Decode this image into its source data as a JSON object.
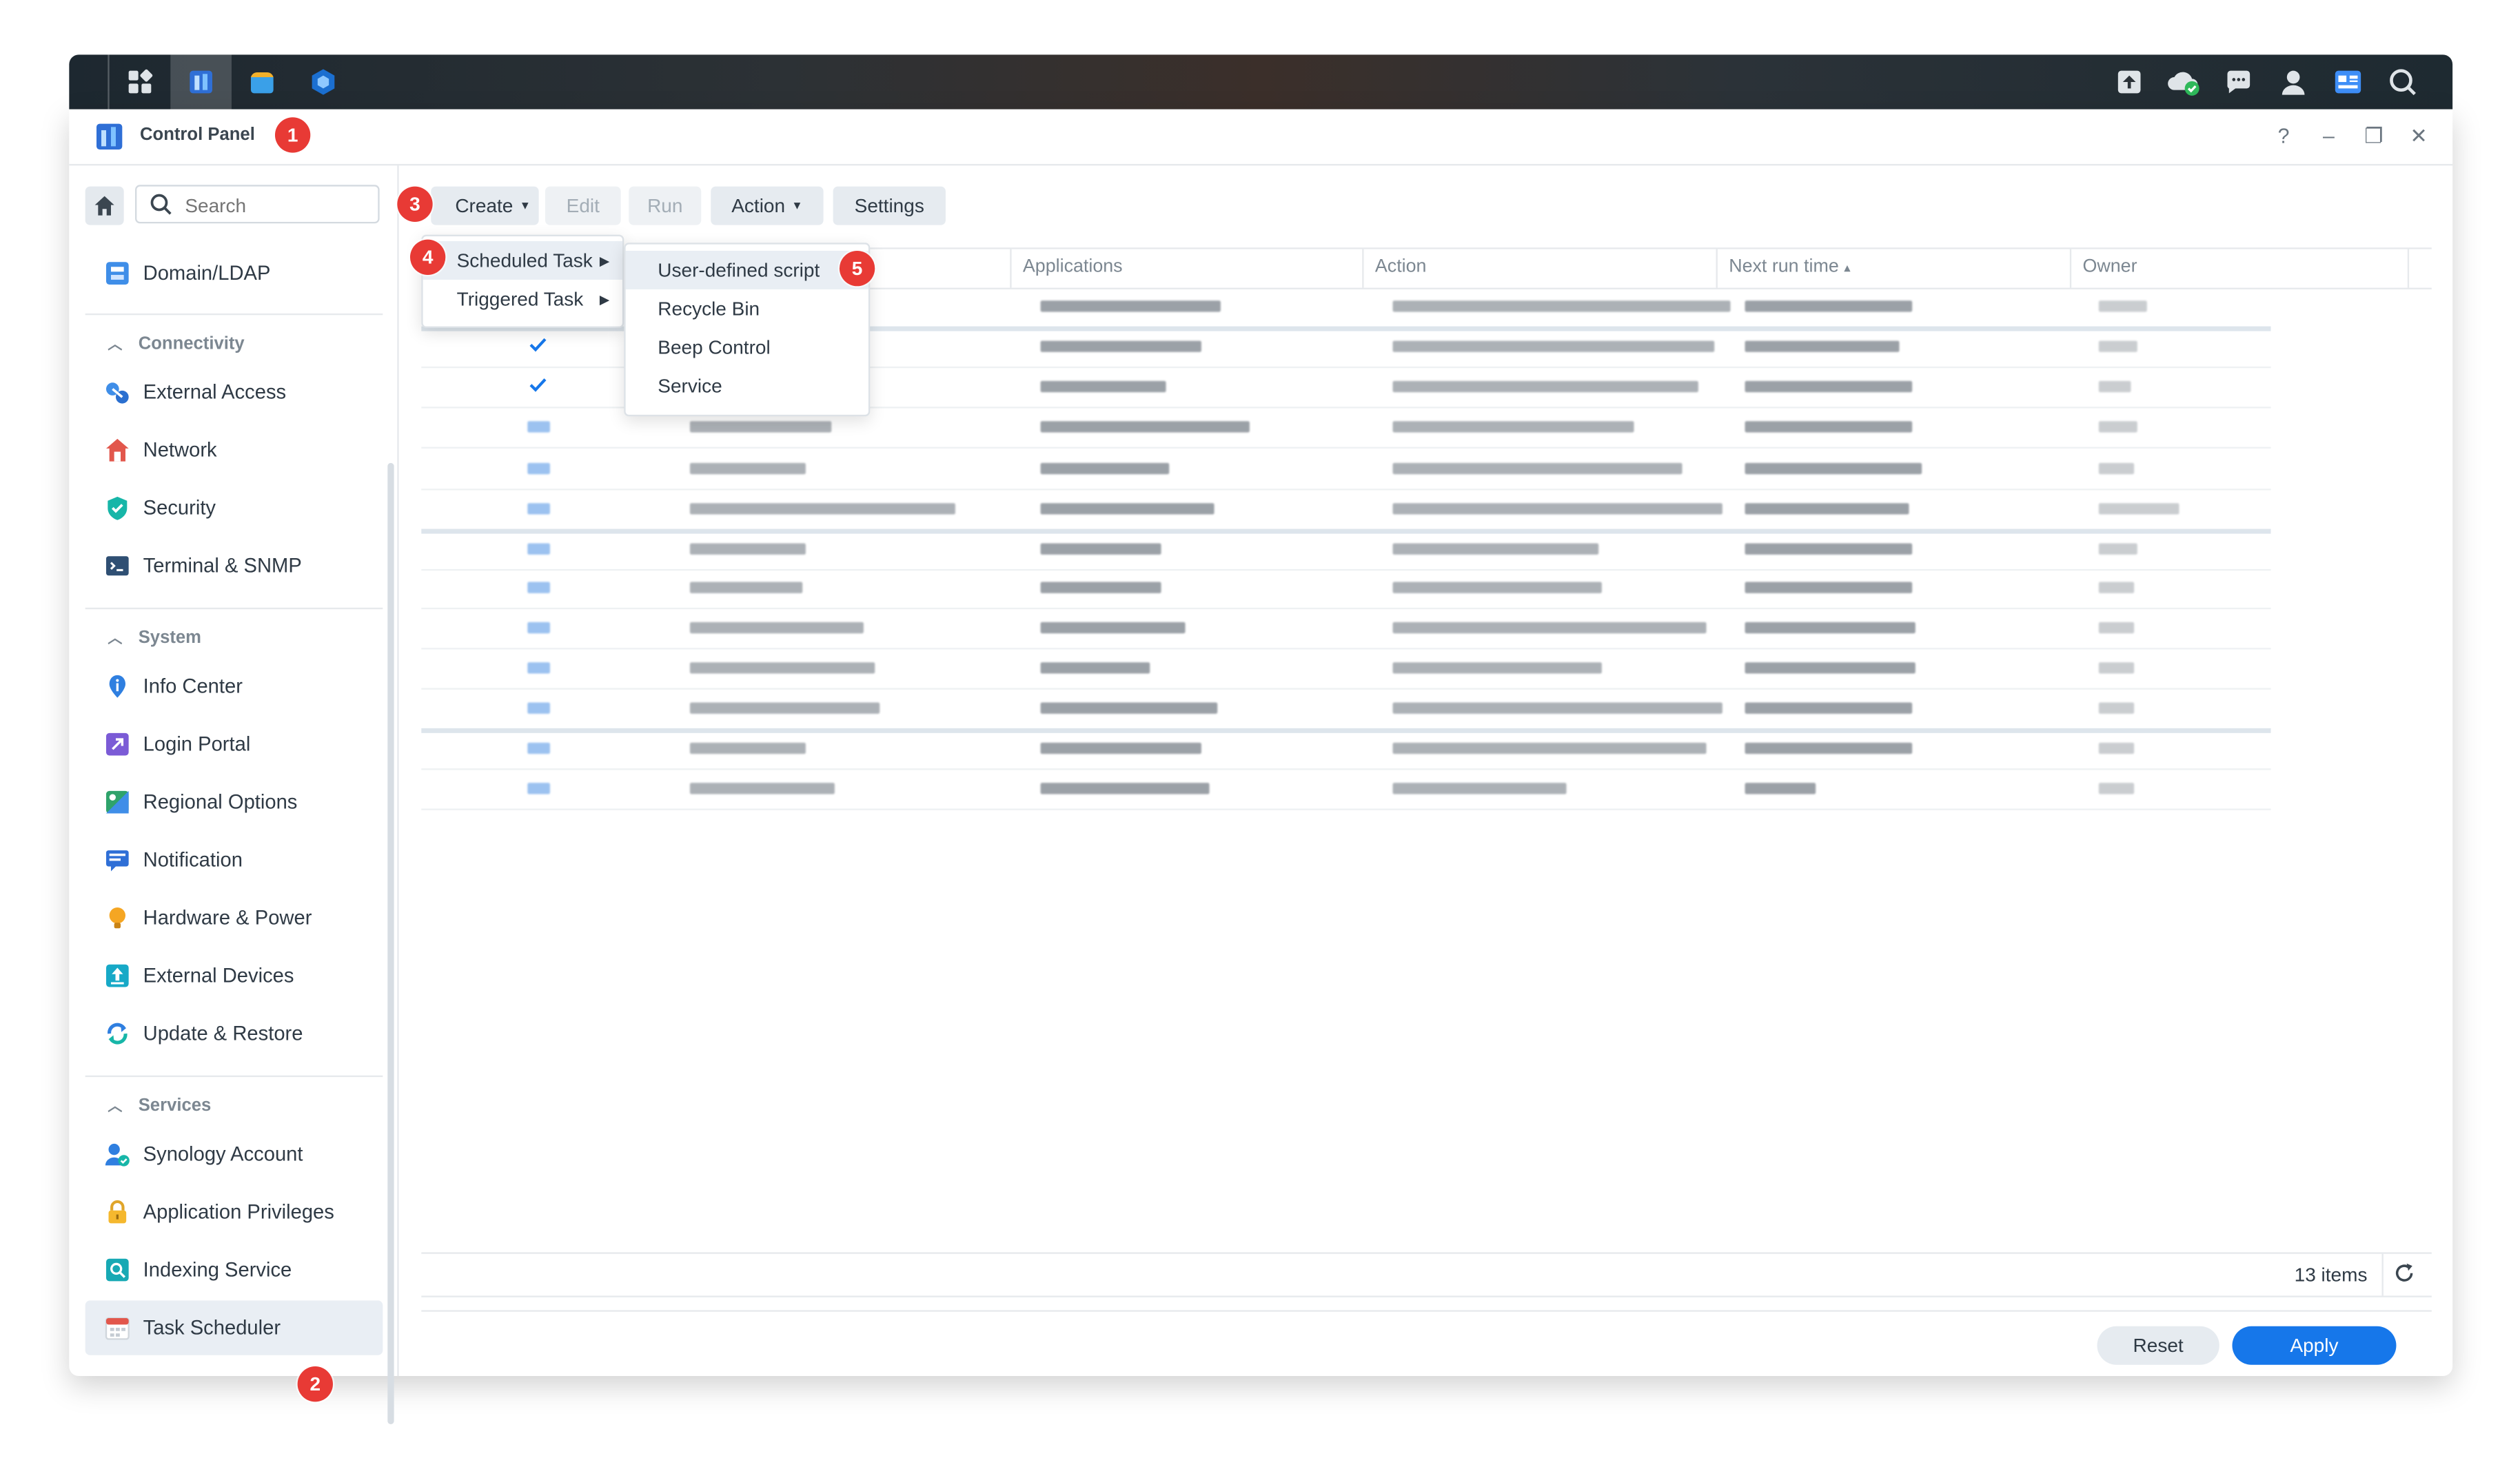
{
  "window": {
    "title": "Control Panel"
  },
  "badges": [
    "1",
    "2",
    "3",
    "4",
    "5"
  ],
  "sidebar": {
    "search_placeholder": "Search",
    "top_items": [
      {
        "label": "Domain/LDAP",
        "icon": "domain-ldap-icon"
      }
    ],
    "sections": [
      {
        "title": "Connectivity",
        "items": [
          {
            "label": "External Access",
            "icon": "external-access-icon"
          },
          {
            "label": "Network",
            "icon": "network-icon"
          },
          {
            "label": "Security",
            "icon": "security-icon"
          },
          {
            "label": "Terminal & SNMP",
            "icon": "terminal-icon"
          }
        ]
      },
      {
        "title": "System",
        "items": [
          {
            "label": "Info Center",
            "icon": "info-center-icon"
          },
          {
            "label": "Login Portal",
            "icon": "login-portal-icon"
          },
          {
            "label": "Regional Options",
            "icon": "regional-options-icon"
          },
          {
            "label": "Notification",
            "icon": "notification-icon"
          },
          {
            "label": "Hardware & Power",
            "icon": "hardware-power-icon"
          },
          {
            "label": "External Devices",
            "icon": "external-devices-icon"
          },
          {
            "label": "Update & Restore",
            "icon": "update-restore-icon"
          }
        ]
      },
      {
        "title": "Services",
        "items": [
          {
            "label": "Synology Account",
            "icon": "synology-account-icon"
          },
          {
            "label": "Application Privileges",
            "icon": "application-privileges-icon"
          },
          {
            "label": "Indexing Service",
            "icon": "indexing-service-icon"
          },
          {
            "label": "Task Scheduler",
            "icon": "task-scheduler-icon",
            "selected": true
          }
        ]
      }
    ]
  },
  "toolbar": {
    "create": "Create",
    "edit": "Edit",
    "run": "Run",
    "action": "Action",
    "settings": "Settings"
  },
  "create_menu": [
    "Scheduled Task",
    "Triggered Task"
  ],
  "scheduled_submenu": [
    "User-defined script",
    "Recycle Bin",
    "Beep Control",
    "Service"
  ],
  "table": {
    "columns": [
      "Applications",
      "Action",
      "Next run time",
      "Owner"
    ],
    "sort_indicator": "▴",
    "row_checked": [
      false,
      true,
      true,
      false,
      false,
      false,
      false,
      false,
      false,
      false,
      false,
      false,
      false
    ]
  },
  "footer": {
    "count": "13 items",
    "reset": "Reset",
    "apply": "Apply"
  },
  "colors": {
    "accent": "#1677ea",
    "badge": "#e83a35",
    "selected_bg": "#e9eef4"
  }
}
